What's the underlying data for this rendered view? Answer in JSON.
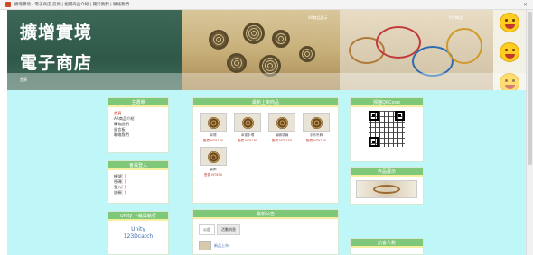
{
  "browser": {
    "tab_title": "擴增實境 - 電子商店 首頁 | 相關商品介紹 | 關於我們 | 聯絡我們"
  },
  "banner": {
    "title_line1": "擴增實境",
    "title_line2": "電子商店",
    "small_text": "首頁",
    "tag_mid": "AR商品展示",
    "tag_right": "手作飾品"
  },
  "left": {
    "menu_title": "主選單",
    "menu_items": [
      "首頁",
      "AR商品介紹",
      "購物說明",
      "留言板",
      "聯絡我們"
    ],
    "stats_title": "會員登入",
    "stats": [
      {
        "label": "帳號",
        "value": "[ ]"
      },
      {
        "label": "密碼",
        "value": "[ ]"
      },
      {
        "label": "登入",
        "value": "[ ]"
      },
      {
        "label": "註冊",
        "value": "[ ]"
      }
    ],
    "unity_title": "Unity 下載與執行",
    "unity_line1": "Unity",
    "unity_line2": "123Dcatch"
  },
  "middle": {
    "products_title": "最新上架商品",
    "products": [
      {
        "name": "耳環",
        "price": "售價 NT$150"
      },
      {
        "name": "幸運手環",
        "price": "售價 NT$180"
      },
      {
        "name": "編織項鍊",
        "price": "售價 NT$250"
      },
      {
        "name": "手作吊飾",
        "price": "售價 NT$120"
      },
      {
        "name": "髮飾",
        "price": "售價 NT$90"
      }
    ],
    "announce_title": "最新公告",
    "announce_tabs": [
      "公告",
      "活動消息"
    ],
    "announce_items": [
      "新品上市"
    ]
  },
  "right": {
    "qr_title": "掃描QRCode",
    "photo_title": "作品展示",
    "third_title": "訪客人數"
  }
}
